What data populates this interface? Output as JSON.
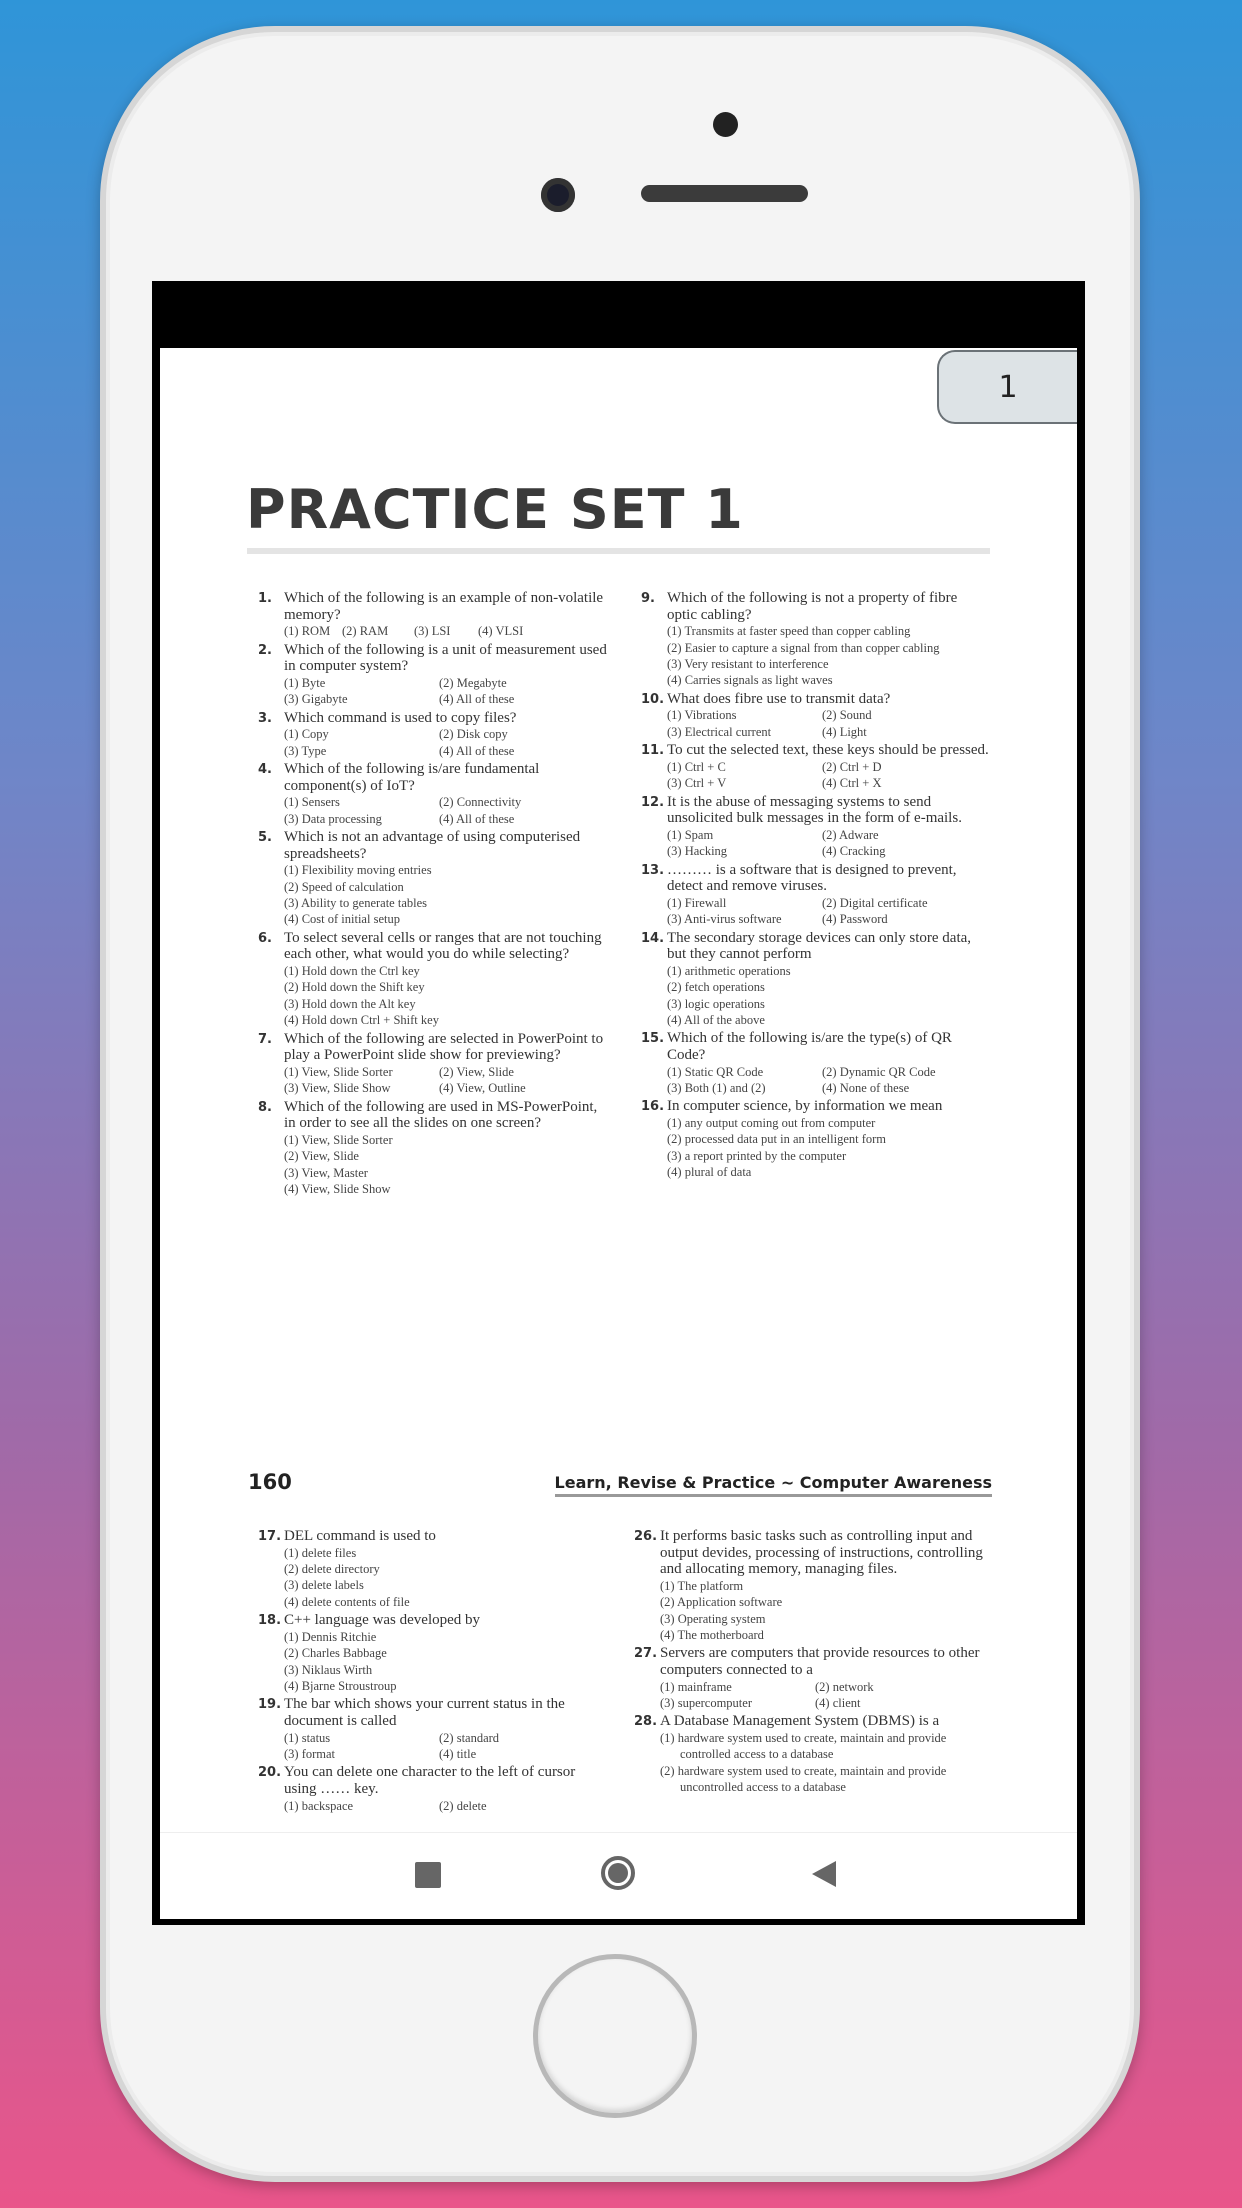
{
  "colors": {
    "background_top": "#2f95d8",
    "background_bottom": "#e9558a",
    "badge": "#dde3e6"
  },
  "page_badge": "1",
  "title": "PRACTICE SET 1",
  "page_number": "160",
  "running_header": "Learn, Revise & Practice ~ Computer Awareness",
  "nav": {
    "recents_icon": "square-icon",
    "home_icon": "circle-icon",
    "back_icon": "triangle-left-icon"
  },
  "page1": {
    "left": [
      {
        "n": "1.",
        "text": "Which of the following is an example of non-volatile memory?",
        "layout": "row4",
        "options": [
          "(1) ROM",
          "(2) RAM",
          "(3) LSI",
          "(4) VLSI"
        ]
      },
      {
        "n": "2.",
        "text": "Which of the following is a unit of measurement used in computer system?",
        "layout": "grid",
        "options": [
          "(1) Byte",
          "(2) Megabyte",
          "(3) Gigabyte",
          "(4) All of these"
        ]
      },
      {
        "n": "3.",
        "text": "Which command is used to copy files?",
        "layout": "grid",
        "options": [
          "(1) Copy",
          "(2) Disk copy",
          "(3) Type",
          "(4) All of these"
        ]
      },
      {
        "n": "4.",
        "text": "Which of the following is/are fundamental component(s) of IoT?",
        "layout": "grid",
        "options": [
          "(1) Sensers",
          "(2) Connectivity",
          "(3) Data processing",
          "(4) All of these"
        ]
      },
      {
        "n": "5.",
        "text": "Which is not an advantage of using computerised spreadsheets?",
        "layout": "list",
        "options": [
          "(1) Flexibility moving entries",
          "(2) Speed of calculation",
          "(3) Ability to generate tables",
          "(4) Cost of initial setup"
        ]
      },
      {
        "n": "6.",
        "text": "To select several cells or ranges that are not touching each other, what would you do while selecting?",
        "layout": "list",
        "options": [
          "(1) Hold down the Ctrl key",
          "(2) Hold down the Shift key",
          "(3) Hold down the Alt key",
          "(4) Hold down Ctrl + Shift key"
        ]
      },
      {
        "n": "7.",
        "text": "Which of the following are selected in PowerPoint to play a PowerPoint slide show for previewing?",
        "layout": "grid",
        "options": [
          "(1) View, Slide Sorter",
          "(2) View, Slide",
          "(3) View, Slide Show",
          "(4) View, Outline"
        ]
      },
      {
        "n": "8.",
        "text": "Which of the following are used in MS-PowerPoint, in order to see all the slides on one screen?",
        "layout": "list",
        "options": [
          "(1) View, Slide Sorter",
          "(2) View, Slide",
          "(3) View, Master",
          "(4) View, Slide Show"
        ]
      }
    ],
    "right": [
      {
        "n": "9.",
        "text": "Which of the following is not a property of fibre optic cabling?",
        "layout": "list",
        "options": [
          "(1) Transmits at faster speed than copper cabling",
          "(2) Easier to capture a signal from than copper cabling",
          "(3) Very resistant to interference",
          "(4) Carries signals as light waves"
        ]
      },
      {
        "n": "10.",
        "text": "What does fibre use to transmit data?",
        "layout": "grid",
        "options": [
          "(1) Vibrations",
          "(2) Sound",
          "(3) Electrical current",
          "(4) Light"
        ]
      },
      {
        "n": "11.",
        "text": "To cut the selected text, these keys should be pressed.",
        "layout": "grid",
        "options": [
          "(1) Ctrl + C",
          "(2) Ctrl + D",
          "(3) Ctrl + V",
          "(4) Ctrl + X"
        ]
      },
      {
        "n": "12.",
        "text": "It is the abuse of messaging systems to send unsolicited bulk messages in the form of e-mails.",
        "layout": "grid",
        "options": [
          "(1) Spam",
          "(2) Adware",
          "(3) Hacking",
          "(4) Cracking"
        ]
      },
      {
        "n": "13.",
        "text": "……… is a software that is designed to prevent, detect and remove viruses.",
        "layout": "grid",
        "options": [
          "(1) Firewall",
          "(2) Digital certificate",
          "(3) Anti-virus software",
          "(4) Password"
        ]
      },
      {
        "n": "14.",
        "text": "The secondary storage devices can only store data, but they cannot perform",
        "layout": "list",
        "options": [
          "(1) arithmetic operations",
          "(2) fetch operations",
          "(3) logic operations",
          "(4) All of the above"
        ]
      },
      {
        "n": "15.",
        "text": "Which of the following is/are the type(s) of QR Code?",
        "layout": "grid",
        "options": [
          "(1) Static QR Code",
          "(2) Dynamic QR Code",
          "(3) Both (1) and (2)",
          "(4) None of these"
        ]
      },
      {
        "n": "16.",
        "text": "In computer science, by information we mean",
        "layout": "list",
        "options": [
          "(1) any output coming out from computer",
          "(2) processed data put in an intelligent form",
          "(3) a report printed by the computer",
          "(4) plural of data"
        ]
      }
    ]
  },
  "page2": {
    "left": [
      {
        "n": "17.",
        "text": "DEL command is used to",
        "layout": "list",
        "options": [
          "(1) delete files",
          "(2) delete directory",
          "(3) delete labels",
          "(4) delete contents of file"
        ]
      },
      {
        "n": "18.",
        "text": "C++ language was developed by",
        "layout": "list",
        "options": [
          "(1) Dennis Ritchie",
          "(2) Charles Babbage",
          "(3) Niklaus Wirth",
          "(4) Bjarne Stroustroup"
        ]
      },
      {
        "n": "19.",
        "text": "The bar which shows your current status in the document is called",
        "layout": "grid",
        "options": [
          "(1) status",
          "(2) standard",
          "(3) format",
          "(4) title"
        ]
      },
      {
        "n": "20.",
        "text": "You can delete one character to the left of cursor using …… key.",
        "layout": "grid",
        "options": [
          "(1) backspace",
          "(2) delete"
        ]
      }
    ],
    "right": [
      {
        "n": "26.",
        "text": "It performs basic tasks such as controlling input and output devides, processing of instructions, controlling and allocating memory, managing files.",
        "layout": "list",
        "options": [
          "(1) The platform",
          "(2) Application software",
          "(3) Operating system",
          "(4) The motherboard"
        ]
      },
      {
        "n": "27.",
        "text": "Servers are computers that provide resources to other computers connected to a",
        "layout": "grid",
        "options": [
          "(1) mainframe",
          "(2) network",
          "(3) supercomputer",
          "(4) client"
        ]
      },
      {
        "n": "28.",
        "text": "A Database Management System (DBMS) is a",
        "layout": "list",
        "options": [
          "(1) hardware system used to create, maintain and provide controlled access to a database",
          "(2) hardware system used to create, maintain and provide uncontrolled access to a database"
        ]
      }
    ]
  }
}
